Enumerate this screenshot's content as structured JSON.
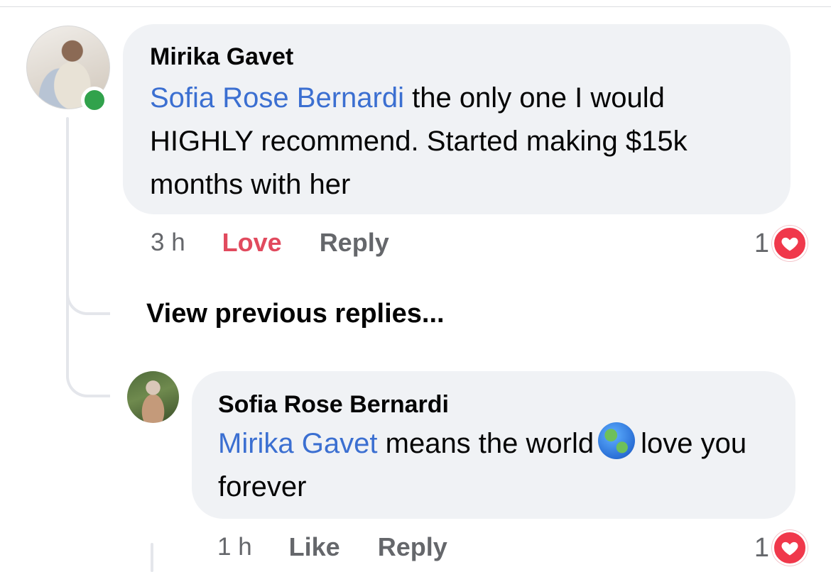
{
  "comment": {
    "author": "Mirika Gavet",
    "mention": "Sofia Rose Bernardi",
    "text": "the only one I would HIGHLY recommend. Started making $15k months with her",
    "time": "3 h",
    "love_label": "Love",
    "reply_label": "Reply",
    "reaction_count": "1",
    "reaction_icon": "heart-icon",
    "online_status_color": "#31a24c",
    "mention_color": "#3b6fd1",
    "love_color": "#e14a5e"
  },
  "view_previous_label": "View previous replies...",
  "reply": {
    "author": "Sofia Rose Bernardi",
    "mention": "Mirika Gavet",
    "text_before": "means the world",
    "emoji": "globe-americas-icon",
    "text_after": "love you forever",
    "time": "1 h",
    "like_label": "Like",
    "reply_label": "Reply",
    "reaction_count": "1",
    "reaction_icon": "heart-icon"
  }
}
